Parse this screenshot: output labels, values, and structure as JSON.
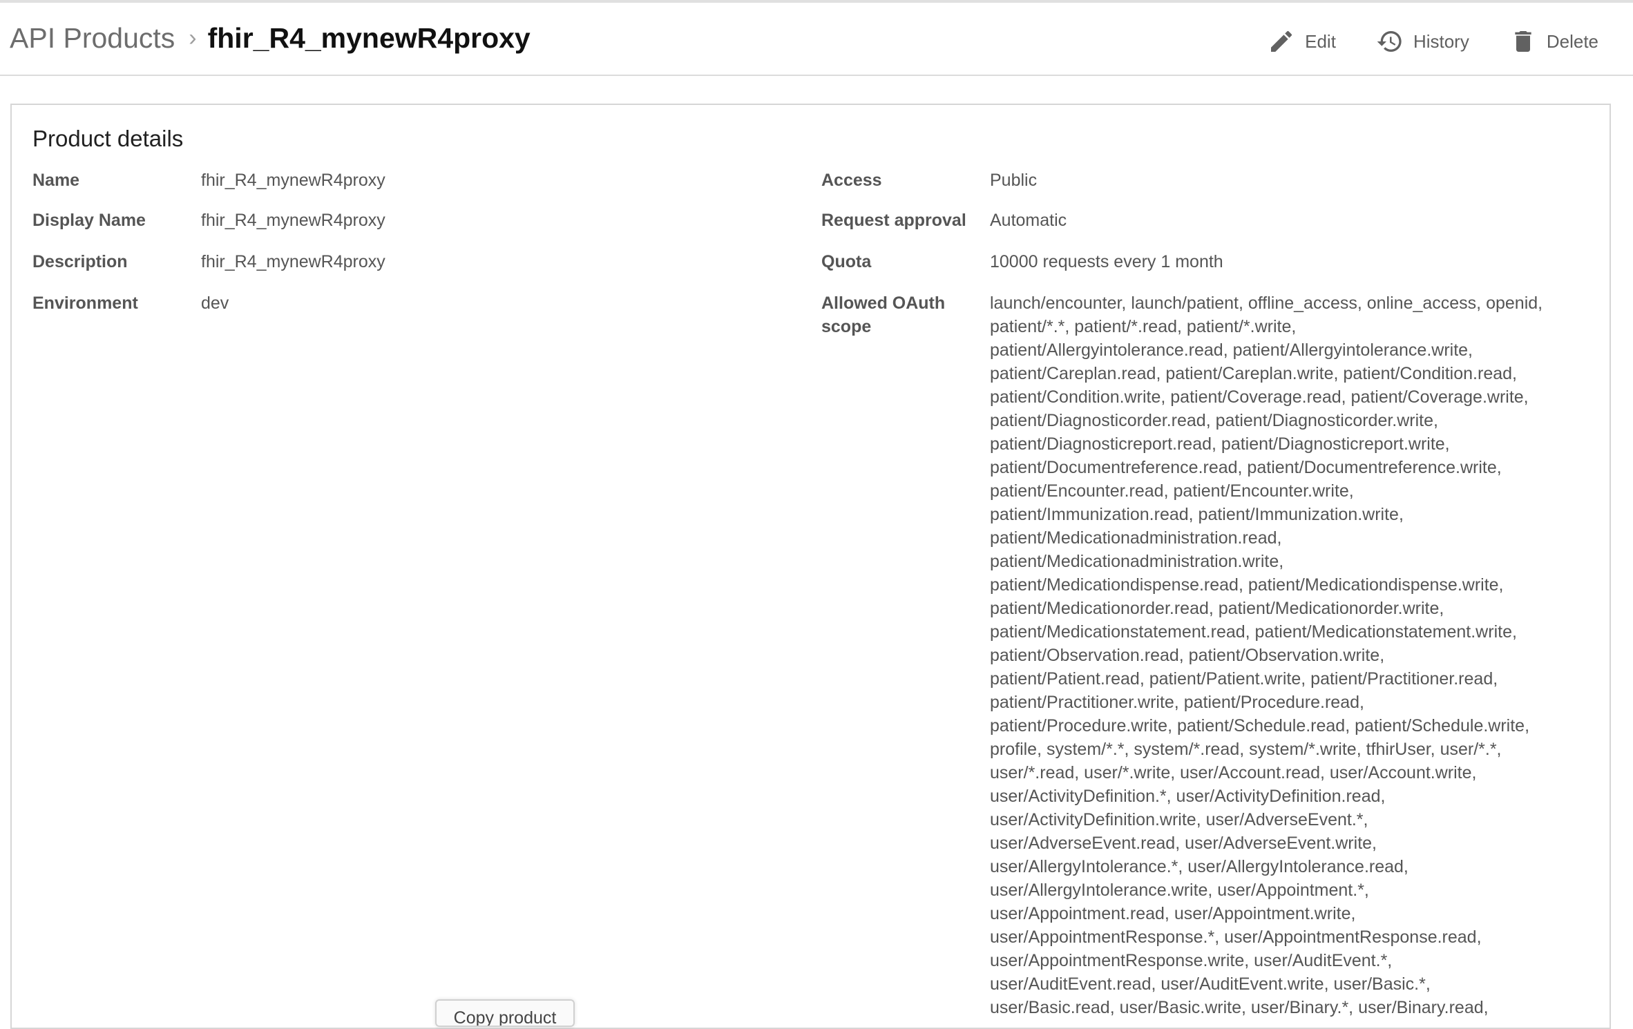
{
  "breadcrumb": {
    "root": "API Products",
    "separator": "›",
    "current": "fhir_R4_mynewR4proxy"
  },
  "actions": {
    "edit": "Edit",
    "history": "History",
    "delete": "Delete"
  },
  "panel": {
    "title": "Product details",
    "left": [
      {
        "label": "Name",
        "value": "fhir_R4_mynewR4proxy"
      },
      {
        "label": "Display Name",
        "value": "fhir_R4_mynewR4proxy"
      },
      {
        "label": "Description",
        "value": "fhir_R4_mynewR4proxy"
      },
      {
        "label": "Environment",
        "value": "dev"
      }
    ],
    "right": [
      {
        "label": "Access",
        "value": "Public"
      },
      {
        "label": "Request approval",
        "value": "Automatic"
      },
      {
        "label": "Quota",
        "value": "10000 requests every 1 month"
      }
    ],
    "scope_label_line1": "Allowed OAuth",
    "scope_label_line2": "scope",
    "scope_lines": [
      "launch/encounter, launch/patient, offline_access, online_access, openid,",
      "patient/*.*, patient/*.read, patient/*.write,",
      "patient/Allergyintolerance.read, patient/Allergyintolerance.write,",
      "patient/Careplan.read, patient/Careplan.write, patient/Condition.read,",
      "patient/Condition.write, patient/Coverage.read, patient/Coverage.write,",
      "patient/Diagnosticorder.read, patient/Diagnosticorder.write,",
      "patient/Diagnosticreport.read, patient/Diagnosticreport.write,",
      "patient/Documentreference.read, patient/Documentreference.write,",
      "patient/Encounter.read, patient/Encounter.write,",
      "patient/Immunization.read, patient/Immunization.write,",
      "patient/Medicationadministration.read,",
      "patient/Medicationadministration.write,",
      "patient/Medicationdispense.read, patient/Medicationdispense.write,",
      "patient/Medicationorder.read, patient/Medicationorder.write,",
      "patient/Medicationstatement.read, patient/Medicationstatement.write,",
      "patient/Observation.read, patient/Observation.write,",
      "patient/Patient.read, patient/Patient.write, patient/Practitioner.read,",
      "patient/Practitioner.write, patient/Procedure.read,",
      "patient/Procedure.write, patient/Schedule.read, patient/Schedule.write,",
      "profile, system/*.*, system/*.read, system/*.write, tfhirUser, user/*.*,",
      "user/*.read, user/*.write, user/Account.read, user/Account.write,",
      "user/ActivityDefinition.*, user/ActivityDefinition.read,",
      "user/ActivityDefinition.write, user/AdverseEvent.*,",
      "user/AdverseEvent.read, user/AdverseEvent.write,",
      "user/AllergyIntolerance.*, user/AllergyIntolerance.read,",
      "user/AllergyIntolerance.write, user/Appointment.*,",
      "user/Appointment.read, user/Appointment.write,",
      "user/AppointmentResponse.*, user/AppointmentResponse.read,",
      "user/AppointmentResponse.write, user/AuditEvent.*,",
      "user/AuditEvent.read, user/AuditEvent.write, user/Basic.*,",
      "user/Basic.read, user/Basic.write, user/Binary.*, user/Binary.read,"
    ]
  },
  "floating_button": {
    "label": "Copy product"
  },
  "icons": {
    "edit": "pencil-icon",
    "history": "history-icon",
    "delete": "trash-icon"
  }
}
